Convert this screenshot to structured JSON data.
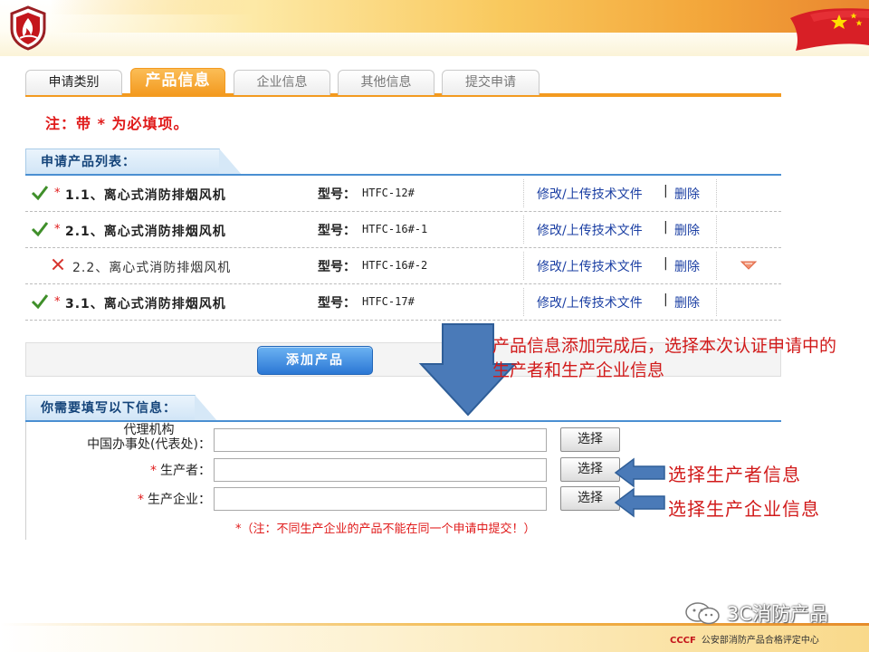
{
  "tabs": [
    {
      "label": "申请类别",
      "state": "normal"
    },
    {
      "label": "产品信息",
      "state": "active"
    },
    {
      "label": "企业信息",
      "state": "disabled"
    },
    {
      "label": "其他信息",
      "state": "disabled"
    },
    {
      "label": "提交申请",
      "state": "disabled"
    }
  ],
  "required_note": "注：带 * 为必填项。",
  "product_list": {
    "title": "申请产品列表：",
    "model_label": "型号：",
    "edit_label": "修改/上传技术文件",
    "separator": "|",
    "delete_label": "删除",
    "rows": [
      {
        "status": "check-icon",
        "required": "*",
        "name": "1.1、离心式消防排烟风机",
        "model": "HTFC-12#"
      },
      {
        "status": "check-icon",
        "required": "*",
        "name": "2.1、离心式消防排烟风机",
        "model": "HTFC-16#-1"
      },
      {
        "status": "cross-icon",
        "required": "",
        "name": "2.2、离心式消防排烟风机",
        "model": "HTFC-16#-2"
      },
      {
        "status": "check-icon",
        "required": "*",
        "name": "3.1、离心式消防排烟风机",
        "model": "HTFC-17#"
      }
    ]
  },
  "add_product_label": "添加产品",
  "info_section": {
    "title": "你需要填写以下信息：",
    "fields": [
      {
        "label_line1": "代理机构",
        "label_line2": "中国办事处(代表处)：",
        "required": "",
        "value": "",
        "button": "选择"
      },
      {
        "label": "生产者：",
        "required": "*",
        "value": "",
        "button": "选择"
      },
      {
        "label": "生产企业：",
        "required": "*",
        "value": "",
        "button": "选择"
      }
    ],
    "note": "*（注：不同生产企业的产品不能在同一个申请中提交！）"
  },
  "annotations": {
    "callout_main": "产品信息添加完成后，选择本次认证申请中的生产者和生产企业信息",
    "callout_producer": "选择生产者信息",
    "callout_enterprise": "选择生产企业信息"
  },
  "footer": {
    "wechat_label": "3C消防产品",
    "brand": "CCCF",
    "org": "公安部消防产品合格评定中心"
  },
  "colors": {
    "accent_orange": "#f39a1f",
    "link_blue": "#1b3fa3",
    "required_red": "#e01a1a",
    "annotation_red": "#d11a1a",
    "arrow_blue": "#4a7ab8",
    "section_blue": "#4a8fd2"
  }
}
